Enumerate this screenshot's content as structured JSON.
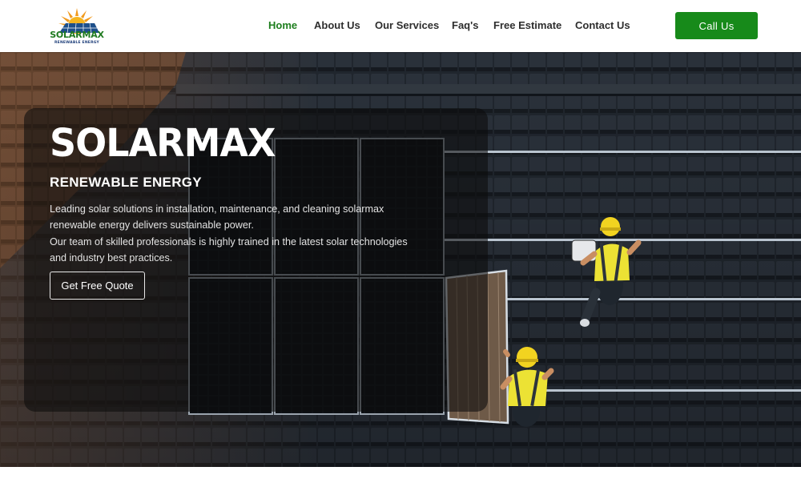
{
  "brand": {
    "name": "SOLARMAX",
    "tagline": "RENEWABLE ENERGY",
    "primary_color": "#178a1a"
  },
  "nav": {
    "items": [
      {
        "label": "Home",
        "active": true
      },
      {
        "label": "About Us",
        "active": false
      },
      {
        "label": "Our Services",
        "active": false
      },
      {
        "label": "Faq's",
        "active": false
      },
      {
        "label": "Free Estimate",
        "active": false
      },
      {
        "label": "Contact Us",
        "active": false
      }
    ],
    "cta_label": "Call Us"
  },
  "hero": {
    "title": "SOLARMAX",
    "subtitle": "RENEWABLE ENERGY",
    "description_lines": [
      "Leading solar solutions in installation, maintenance, and cleaning solarmax",
      "renewable energy delivers sustainable power.",
      "Our team of skilled professionals is highly trained in the latest solar technologies",
      "and industry best practices."
    ],
    "button_label": "Get Free Quote",
    "background_icon": "rooftop-solar-installation-image"
  }
}
